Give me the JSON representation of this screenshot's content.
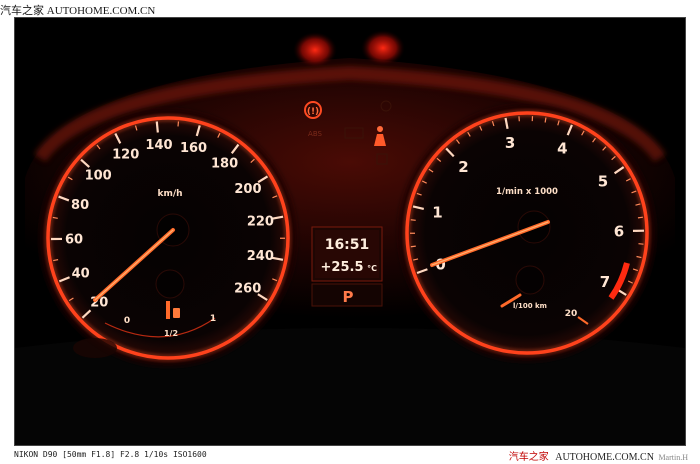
{
  "watermark_top": {
    "brand_cn": "汽车之家",
    "brand_en": "AUTOHOME.COM.CN"
  },
  "speedometer": {
    "unit": "km/h",
    "labels": [
      "20",
      "40",
      "60",
      "80",
      "100",
      "120",
      "140",
      "160",
      "180",
      "200",
      "220",
      "240",
      "260"
    ],
    "needle_value_kmh": 0,
    "fuel_gauge": {
      "labels": [
        "0",
        "1/2",
        "1"
      ]
    }
  },
  "tachometer": {
    "unit": "1/min x 1000",
    "labels": [
      "0",
      "1",
      "2",
      "3",
      "4",
      "5",
      "6",
      "7"
    ],
    "needle_value": 0.8,
    "consumption_gauge": {
      "unit": "l/100 km",
      "labels": [
        "20"
      ]
    }
  },
  "center_display": {
    "time": "16:51",
    "temperature": "+25.5",
    "temp_unit": "°C",
    "gear": "P"
  },
  "warning_lights": {
    "abs_label": "ABS"
  },
  "caption": {
    "camera_info": "NIKON D90 [50mm F1.8] F2.8 1/10s ISO1600",
    "brand_cn": "汽车之家",
    "brand_en": "AUTOHOME.COM.CN",
    "author": "Martin.H"
  },
  "colors": {
    "glow": "#ff3b1a",
    "ring": "#ff4a22",
    "text": "#ffe0c8",
    "background": "#000000"
  }
}
